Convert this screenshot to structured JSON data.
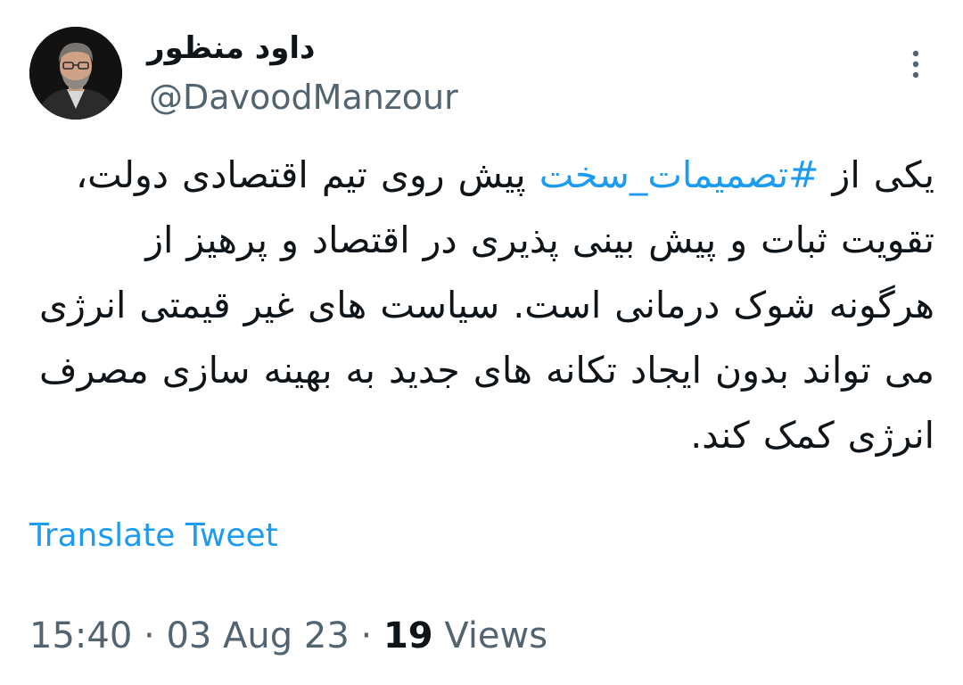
{
  "author": {
    "display_name": "داود منظور",
    "handle": "@DavoodManzour",
    "avatar_icon": "profile-photo"
  },
  "menu": {
    "icon": "more-vertical-icon"
  },
  "tweet": {
    "text_before": "یکی از ",
    "hashtag": "#تصمیمات_سخت",
    "text_after": " پیش روی تیم اقتصادی دولت، تقویت ثبات و پیش بینی پذیری در اقتصاد و پرهیز از هرگونه شوک درمانی است. سیاست های غیر قیمتی انرژی می تواند بدون ایجاد تکانه های جدید به بهینه سازی مصرف انرژی کمک کند."
  },
  "translate_label": "Translate Tweet",
  "meta": {
    "time": "15:40",
    "separator": "·",
    "date": "03 Aug 23",
    "views_count": "19",
    "views_label": "Views"
  },
  "colors": {
    "link": "#1d9bf0",
    "secondary_text": "#536471",
    "primary_text": "#0f1419"
  }
}
